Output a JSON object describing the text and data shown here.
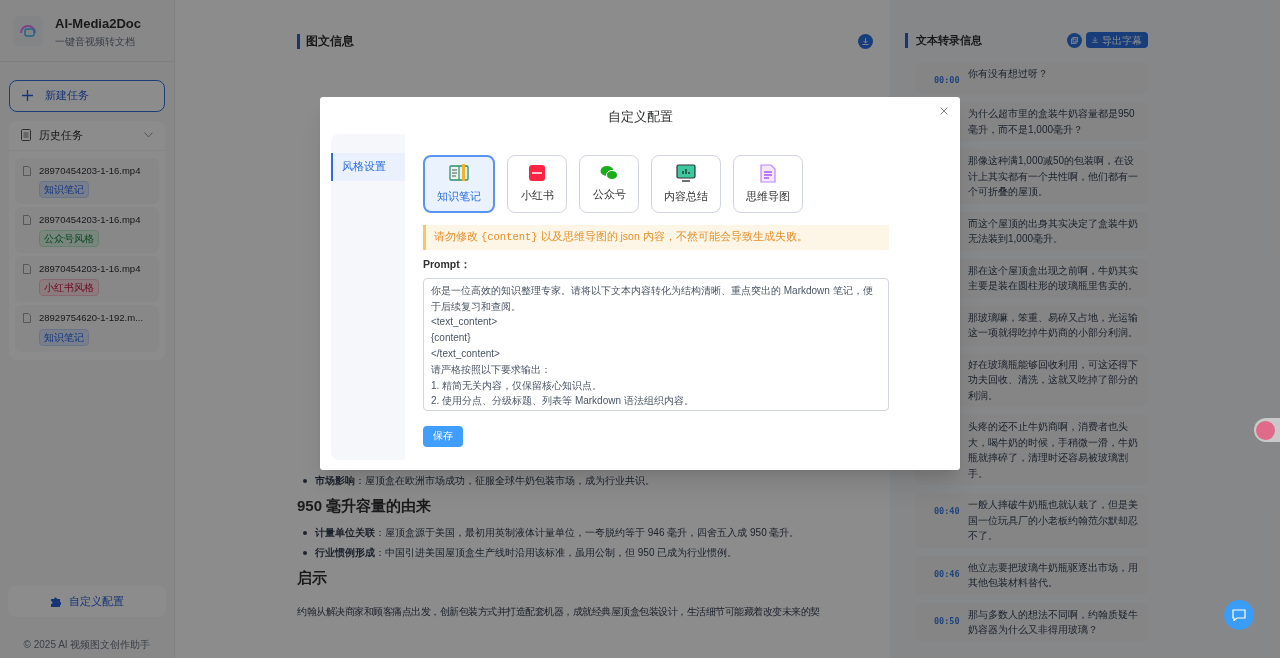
{
  "sidebar": {
    "app_title": "AI-Media2Doc",
    "app_subtitle": "一键音视频转文档",
    "new_task": "新建任务",
    "history": {
      "title": "历史任务",
      "expanded": true,
      "items": [
        {
          "name": "28970454203-1-16.mp4",
          "tag": "知识笔记",
          "kind": "notes"
        },
        {
          "name": "28970454203-1-16.mp4",
          "tag": "公众号风格",
          "kind": "wechat"
        },
        {
          "name": "28970454203-1-16.mp4",
          "tag": "小红书风格",
          "kind": "xhs"
        },
        {
          "name": "28929754620-1-192.m...",
          "tag": "知识笔记",
          "kind": "notes"
        }
      ]
    },
    "config_button": "自定义配置",
    "footer": "© 2025 AI 视频图文创作助手"
  },
  "article": {
    "title": "图文信息",
    "partial_line": "**市场影响**：屋顶盒在欧洲市场成功，征服全球牛奶包装市场，成为行业共识。",
    "sections": [
      {
        "heading": "950 毫升容量的由来",
        "bullets": [
          "**计量单位关联**：屋顶盒源于美国，最初用英制液体计量单位，一夸脱约等于 946 毫升，四舍五入成 950 毫升。",
          "**行业惯例形成**：中国引进美国屋顶盒生产线时沿用该标准，虽用公制，但 950 已成为行业惯例。"
        ]
      },
      {
        "heading": "启示",
        "paragraph": "约翰从解决商家和顾客痛点出发，创新包装方式并打造配套机器，成就经典屋顶盒包装设计，生活细节可能藏着改变未来的契"
      }
    ]
  },
  "transcript": {
    "title": "文本转录信息",
    "export_button": "导出字幕",
    "entries": [
      {
        "time": "00:00",
        "text": "你有没有想过呀？"
      },
      {
        "text": "为什么超市里的盒装牛奶容量都是950毫升，而不是1,000毫升？"
      },
      {
        "text": "那像这种满1,000减50的包装啊，在设计上其实都有一个共性啊，他们都有一个可折叠的屋顶。"
      },
      {
        "text": "而这个屋顶的出身其实决定了盒装牛奶无法装到1,000毫升。"
      },
      {
        "text": "那在这个屋顶盒出现之前啊，牛奶其实主要是装在圆柱形的玻璃瓶里售卖的。"
      },
      {
        "text": "那玻璃嘛，笨重、易碎又占地，光运输这一项就得吃掉牛奶商的小部分利润。"
      },
      {
        "text": "好在玻璃瓶能够回收利用，可这还得下功夫回收、清洗，这就又吃掉了部分的利润。"
      },
      {
        "text": "头疼的还不止牛奶商啊，消费者也头大，喝牛奶的时候，手稍微一滑，牛奶瓶就摔碎了，清理时还容易被玻璃割手。"
      },
      {
        "time": "00:40",
        "text": "一般人摔破牛奶瓶也就认栽了，但是美国一位玩具厂的小老板约翰范尔默却忍不了。"
      },
      {
        "time": "00:46",
        "text": "他立志要把玻璃牛奶瓶驱逐出市场，用其他包装材料替代。"
      },
      {
        "time": "00:50",
        "text": "那与多数人的想法不同啊，约翰质疑牛奶容器为什么又非得用玻璃？"
      }
    ]
  },
  "dialog": {
    "title": "自定义配置",
    "nav": [
      {
        "label": "风格设置",
        "selected": true
      }
    ],
    "styles": [
      {
        "kind": "notes",
        "label": "知识笔记",
        "selected": true
      },
      {
        "kind": "xhs",
        "label": "小红书",
        "selected": false
      },
      {
        "kind": "wechat",
        "label": "公众号",
        "selected": false
      },
      {
        "kind": "summary",
        "label": "内容总结",
        "selected": false
      },
      {
        "kind": "mindmap",
        "label": "思维导图",
        "selected": false
      }
    ],
    "warning": {
      "before": "请勿修改 ",
      "code": "{content}",
      "after": " 以及思维导图的 json 内容，不然可能会导致生成失败。"
    },
    "prompt_label": "Prompt：",
    "prompt": "你是一位高效的知识整理专家。请将以下文本内容转化为结构清晰、重点突出的 Markdown 笔记，便于后续复习和查阅。\n<text_content>\n{content}\n</text_content>\n请严格按照以下要求输出：\n1. 精简无关内容，仅保留核心知识点。\n2. 使用分点、分级标题、列表等 Markdown 语法组织内容。",
    "save": "保存"
  }
}
